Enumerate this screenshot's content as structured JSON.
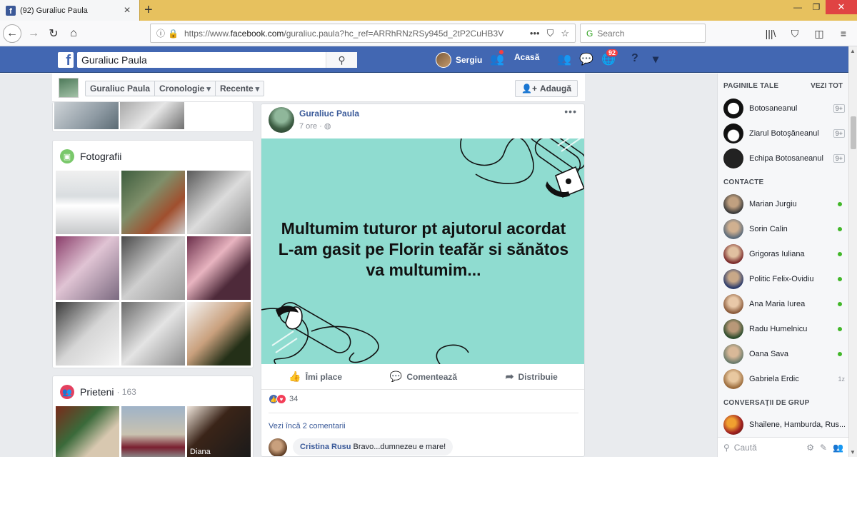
{
  "browser": {
    "tab_title": "(92) Guraliuc Paula",
    "url_prefix": "https://www.",
    "url_domain": "facebook.com",
    "url_rest": "/guraliuc.paula?hc_ref=ARRhRNzRSy945d_2tP2CuHB3V",
    "search_placeholder": "Search"
  },
  "fb_header": {
    "search_value": "Guraliuc Paula",
    "user_name": "Sergiu",
    "home_label": "Acasă",
    "notifications_count": "92"
  },
  "profile_bar": {
    "name": "Guraliuc Paula",
    "timeline": "Cronologie",
    "recent": "Recente",
    "add_friend": "Adaugă"
  },
  "photos_card": {
    "title": "Fotografii"
  },
  "friends_card": {
    "title": "Prieteni",
    "count": "· 163",
    "friend_label": "Diana"
  },
  "post": {
    "author": "Guraliuc Paula",
    "time": "7 ore ·",
    "text": "Multumim tuturor pt ajutorul acordat L-am gasit pe Florin teafăr si sănătos va multumim...",
    "like": "Îmi place",
    "comment": "Comentează",
    "share": "Distribuie",
    "reactions_count": "34",
    "more_comments": "Vezi încă 2 comentarii",
    "comment_author": "Cristina Rusu",
    "comment_text": "Bravo...dumnezeu e mare!"
  },
  "sidebar": {
    "pages_title": "PAGINILE TALE",
    "see_all": "VEZI TOT",
    "pages": [
      {
        "name": "Botosaneanul",
        "badge": "9+"
      },
      {
        "name": "Ziarul Botoşăneanul",
        "badge": "9+"
      },
      {
        "name": "Echipa Botosaneanul",
        "badge": "9+"
      }
    ],
    "contacts_title": "CONTACTE",
    "contacts": [
      {
        "name": "Marian Jurgiu"
      },
      {
        "name": "Sorin Calin"
      },
      {
        "name": "Grigoras Iuliana"
      },
      {
        "name": "Politic Felix-Ovidiu"
      },
      {
        "name": "Ana Maria Iurea"
      },
      {
        "name": "Radu Humelnicu"
      },
      {
        "name": "Oana Sava"
      },
      {
        "name": "Gabriela Erdic",
        "time": "1z"
      }
    ],
    "groups_title": "CONVERSAŢII DE GRUP",
    "group_name": "Shailene, Hamburda, Rus...",
    "chat_search": "Caută"
  }
}
